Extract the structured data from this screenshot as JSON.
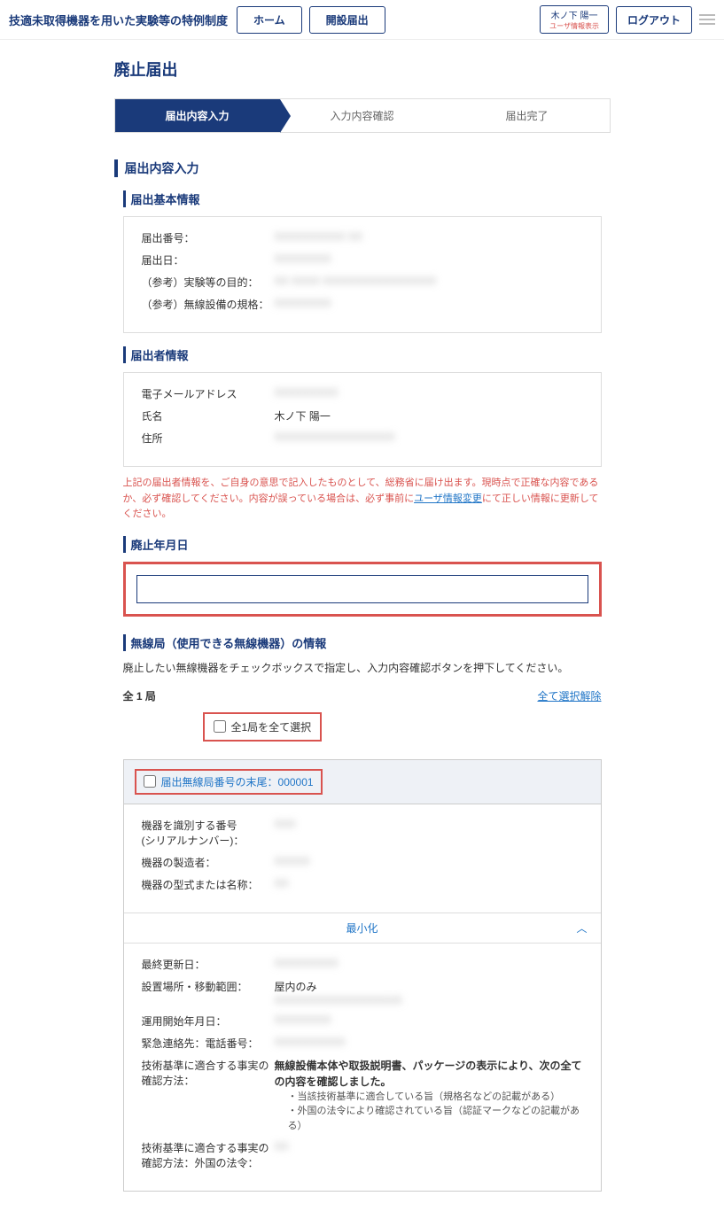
{
  "header": {
    "title": "技適未取得機器を用いた実験等の特例制度",
    "home_btn": "ホーム",
    "open_btn": "開設届出",
    "user_name": "木ノ下 陽一",
    "user_sub": "ユーザ情報表示",
    "logout": "ログアウト"
  },
  "page_title": "廃止届出",
  "stepper": {
    "step1": "届出内容入力",
    "step2": "入力内容確認",
    "step3": "届出完了"
  },
  "section_title": "届出内容入力",
  "basic_info": {
    "title": "届出基本情報",
    "number_label": "届出番号：",
    "number_value": "XXXXXXXXXX XX",
    "date_label": "届出日：",
    "date_value": "XXXXXXXX",
    "purpose_label": "（参考）実験等の目的：",
    "purpose_value": "XX XXXX XXXXXXXXXXXXXXXX",
    "standard_label": "（参考）無線設備の規格：",
    "standard_value": "XXXXXXXX"
  },
  "applicant": {
    "title": "届出者情報",
    "email_label": "電子メールアドレス",
    "email_value": "XXXXXXXXX",
    "name_label": "氏名",
    "name_value": "木ノ下 陽一",
    "address_label": "住所",
    "address_value": "XXXXXXXXXXXXXXXXX"
  },
  "notice": {
    "text1": "上記の届出者情報を、ご自身の意思で記入したものとして、総務省に届け出ます。現時点で正確な内容であるか、必ず確認してください。内容が誤っている場合は、必ず事前に",
    "link": "ユーザ情報変更",
    "text2": "にて正しい情報に更新してください。"
  },
  "abolish_date": {
    "title": "廃止年月日"
  },
  "station": {
    "title": "無線局（使用できる無線機器）の情報",
    "instruction": "廃止したい無線機器をチェックボックスで指定し、入力内容確認ボタンを押下してください。",
    "count": "全 1 局",
    "select_all": "全1局を全て選択",
    "clear_all": "全て選択解除",
    "header_prefix": "届出無線局番号の末尾：",
    "header_number": "000001",
    "serial_label": "機器を識別する番号\n(シリアルナンバー)：",
    "serial_value": "XXX",
    "maker_label": "機器の製造者：",
    "maker_value": "XXXXX",
    "model_label": "機器の型式または名称：",
    "model_value": "XX",
    "minimize": "最小化",
    "updated_label": "最終更新日：",
    "updated_value": "XXXXXXXXX",
    "location_label": "設置場所・移動範囲：",
    "location_value": "屋内のみ",
    "location_value2": "XXXXXXXXXXXXXXXXXX",
    "start_label": "運用開始年月日：",
    "start_value": "XXXXXXXX",
    "emergency_label": "緊急連絡先：電話番号：",
    "emergency_value": "XXXXXXXXXX",
    "confirm_label": "技術基準に適合する事実の確認方法：",
    "confirm_value": "無線設備本体や取扱説明書、パッケージの表示により、次の全ての内容を確認しました。",
    "bullet1": "・当該技術基準に適合している旨（規格名などの記載がある）",
    "bullet2": "・外国の法令により確認されている旨（認証マークなどの記載がある）",
    "foreign_label": "技術基準に適合する事実の確認方法：外国の法令：",
    "foreign_value": "XX"
  }
}
